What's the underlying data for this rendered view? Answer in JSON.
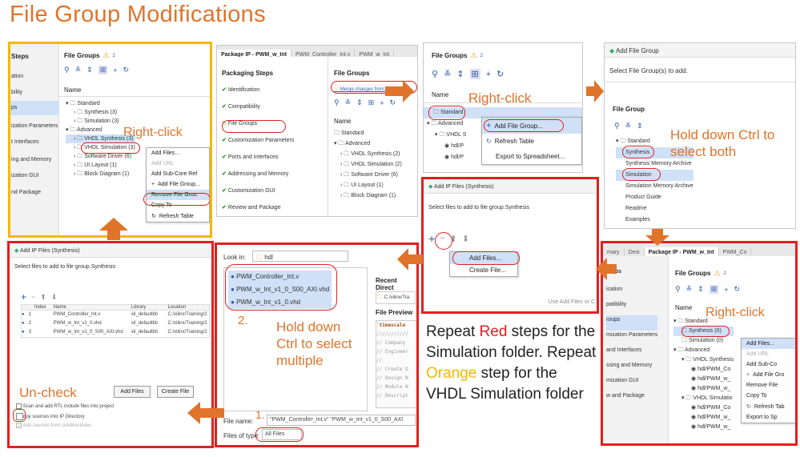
{
  "title": "File Group Modifications",
  "p1": {
    "header": "File Groups",
    "badge": "2",
    "name_col": "Name",
    "side": [
      "Steps",
      "ation",
      "bility",
      "ps",
      "ization Parameters",
      "t Interfaces",
      "ing and Memory",
      "ization GUI",
      "nd Package"
    ],
    "tree": [
      "Standard",
      "Synthesis (3)",
      "Simulation (3)",
      "Advanced",
      "VHDL Synthesis (3)",
      "VHDL Simulation (3)",
      "Software Driver (6)",
      "UI Layout (1)",
      "Block Diagram (1)"
    ],
    "menu": [
      "Add Files...",
      "Add URL",
      "Add Sub-Core Ref",
      "Add File Group...",
      "Remove File Grou",
      "Copy To",
      "Refresh Table"
    ],
    "note": "Right-click"
  },
  "p2": {
    "tabs": [
      "Package IP - PWM_w_Int",
      "PWM_Controller_Int.v",
      "PWM_w_Int"
    ],
    "steps_header": "Packaging Steps",
    "steps": [
      "Identification",
      "Compatibility",
      "File Groups",
      "Customization Parameters",
      "Ports and Interfaces",
      "Addressing and Memory",
      "Customization GUI",
      "Review and Package"
    ],
    "fg_header": "File Groups",
    "merge": "Merge changes from File Gro",
    "name_col": "Name",
    "tree": [
      "Standard",
      "Advanced",
      "VHDL Synthesis (2)",
      "VHDL Simulation (2)",
      "Software Driver (6)",
      "UI Layout (1)",
      "Block Diagram (1)"
    ]
  },
  "p3": {
    "header": "File Groups",
    "badge": "2",
    "name_col": "Name",
    "tree": [
      "Standard",
      "Advanced",
      "VHDL S",
      "hdl/P",
      "hdl/P"
    ],
    "menu": [
      "Add File Group...",
      "Refresh Table",
      "Export to Spreadsheet..."
    ],
    "note": "Right-click"
  },
  "p4": {
    "title": "Add File Group",
    "prompt": "Select File Group(s) to add.",
    "fg_label": "File Group",
    "tree": [
      "Standard",
      "Synthesis",
      "Synthesis Memory Archive",
      "Simulation",
      "Simulation Memory Archive",
      "Product Guide",
      "Readme",
      "Examples"
    ],
    "note": "Hold down Ctrl to select both"
  },
  "p5": {
    "title": "Add IP Files (Synthesis)",
    "prompt": "Select files to add to file group.Synthesis",
    "menu": [
      "Add Files...",
      "Create File..."
    ],
    "hint": "Use Add Files or C"
  },
  "p6": {
    "tabs": [
      "mary",
      "Desi",
      "Package IP - PWM_w_Int",
      "PWM_Co"
    ],
    "side": [
      "Steps",
      "ication",
      "patibility",
      "roups",
      "mization Parameters",
      "and Interfaces",
      "ssing and Memory",
      "mization GUI",
      "w and Package"
    ],
    "header": "File Groups",
    "badge": "2",
    "name_col": "Name",
    "tree": [
      "Standard",
      "Synthesis (0)",
      "Simulation (0)",
      "Advanced",
      "VHDL Synthesis",
      "hdl/PWM_Co",
      "hdl/PWM_w_",
      "hdl/PWM_w_",
      "VHDL Simulatio",
      "hdl/PWM_Co",
      "hdl/PWM_w_",
      "hdl/PWM_w_"
    ],
    "menu": [
      "Add Files...",
      "Add URL",
      "Add Sub-Co",
      "Add File Gro",
      "Remove File",
      "Copy To",
      "Refresh Tab",
      "Export to Sp"
    ],
    "note": "Right-click"
  },
  "p7": {
    "title": "Add IP Files (Synthesis)",
    "prompt": "Select files to add to file group.Synthesis",
    "cols": [
      "Index",
      "Name",
      "Library",
      "Location"
    ],
    "rows": [
      [
        "1",
        "PWM_Controller_Int.v",
        "xil_defaultlib",
        "C:/xilinx/Training/2"
      ],
      [
        "2",
        "PWM_w_Int_v1_0.vhd",
        "xil_defaultlib",
        "C:/xilinx/Training/2"
      ],
      [
        "3",
        "PWM_w_Int_v1_0_S00_AXI.vhd",
        "xil_defaultlib",
        "C:/xilinx/Training/2"
      ]
    ],
    "btn_add": "Add Files",
    "btn_create": "Create File",
    "opt1": "Scan and add RTL include files into project",
    "opt2": "opy sources into IP Directory",
    "opt3": "Add sources from subdirectories",
    "note": "Un-check"
  },
  "p8": {
    "look_in": "Look in:",
    "folder": "hdl",
    "files": [
      "PWM_Controller_Int.v",
      "PWM_w_Int_v1_0_S00_AXI.vhd",
      "PWM_w_Int_v1_0.vhd"
    ],
    "recent": "Recent Direct",
    "recent_path": "C:/xilinx/Tra",
    "preview": "File Preview",
    "preview_lines": [
      "`timescale",
      "///////////",
      "// Company",
      "// Engineer",
      "//",
      "// Create D",
      "// Design N",
      "// Module N",
      "// Descript"
    ],
    "file_name_label": "File name:",
    "file_name_value": "\"PWM_Controller_Int.v\" \"PWM_w_Int_v1_0_S00_AXI",
    "files_of_type_label": "Files of type:",
    "files_of_type_value": "All Files",
    "step1": "1.",
    "step2": "2.",
    "note": "Hold down Ctrl to select multiple"
  },
  "instructions": {
    "a": "Repeat ",
    "red": "Red",
    "b": " steps for the ",
    "sim": "Simulation",
    "c": " folder. Repeat ",
    "orange": "Orange",
    "d": " step for the ",
    "vhdl": "VHDL Simulation",
    "e": " folder"
  }
}
